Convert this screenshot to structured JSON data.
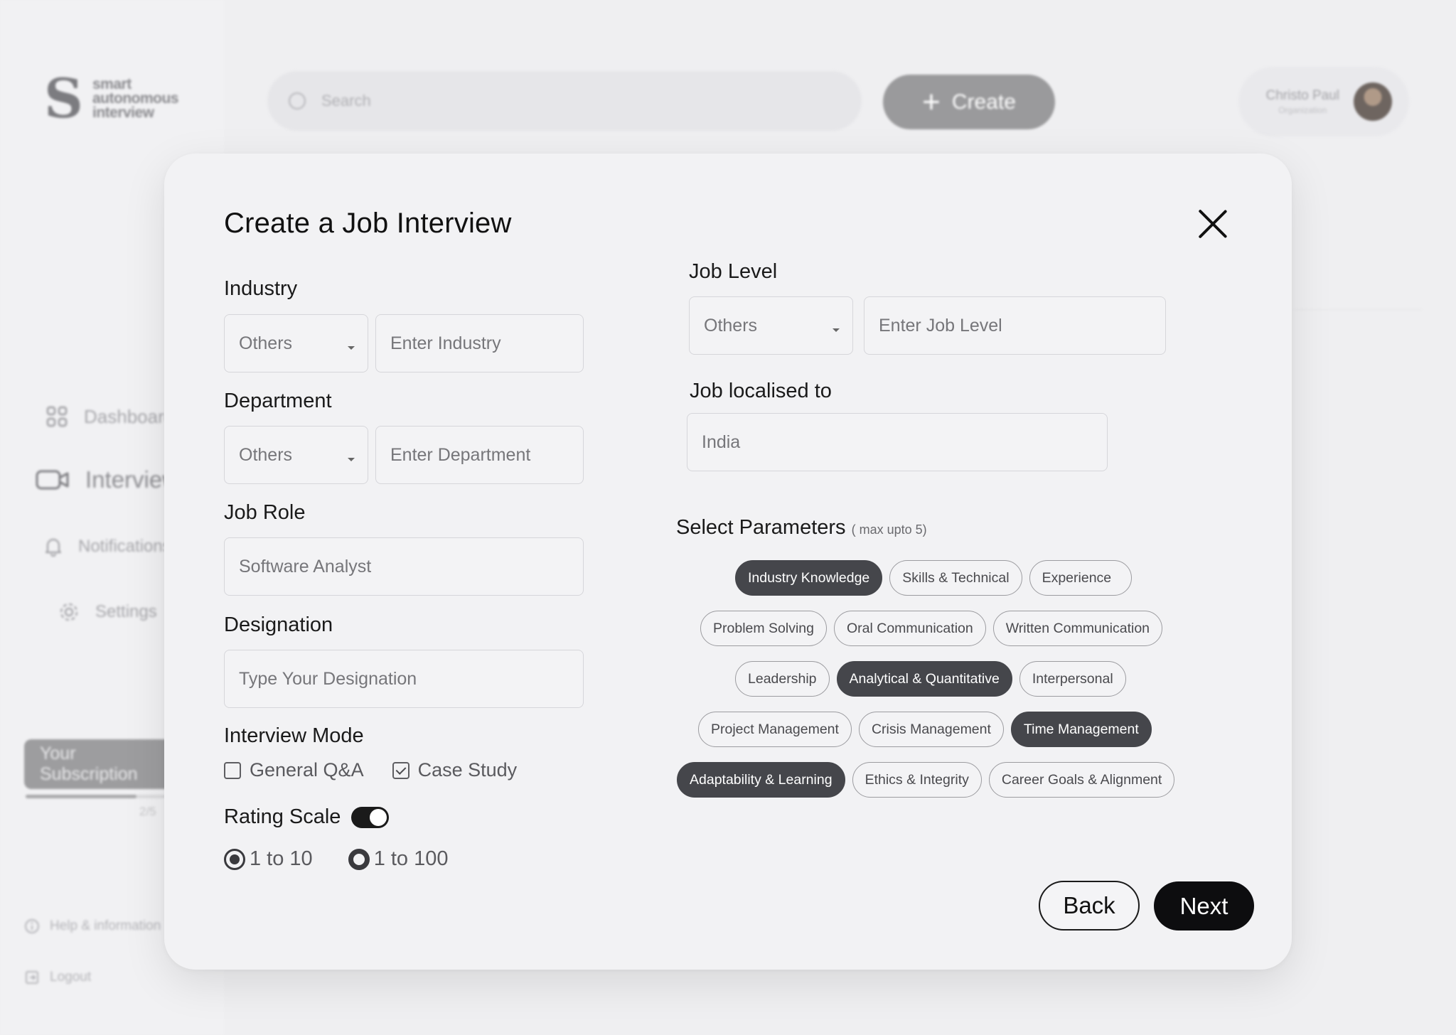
{
  "app": {
    "logo_lines": [
      "smart",
      "autonomous",
      "interview"
    ],
    "search_placeholder": "Search",
    "create_label": "Create",
    "user_name": "Christo Paul",
    "user_role": "Organization"
  },
  "sidebar": {
    "items": [
      {
        "label": "Dashboard",
        "icon": "grid-icon"
      },
      {
        "label": "Interviews",
        "icon": "video-camera-icon"
      },
      {
        "label": "Notifications",
        "icon": "bell-icon"
      },
      {
        "label": "Settings",
        "icon": "gear-icon"
      }
    ],
    "subscription_label": "Your Subscription",
    "subscription_count": "2/5",
    "subscription_progress": 0.78,
    "help_label": "Help & information",
    "logout_label": "Logout"
  },
  "modal": {
    "title": "Create a Job Interview",
    "industry": {
      "label": "Industry",
      "select_value": "Others",
      "input_placeholder": "Enter Industry"
    },
    "department": {
      "label": "Department",
      "select_value": "Others",
      "input_placeholder": "Enter  Department"
    },
    "job_role": {
      "label": "Job Role",
      "value": "Software Analyst"
    },
    "designation": {
      "label": "Designation",
      "placeholder": "Type Your Designation"
    },
    "interview_mode": {
      "label": "Interview Mode",
      "options": [
        {
          "label": "General Q&A",
          "checked": false
        },
        {
          "label": "Case Study",
          "checked": true
        }
      ]
    },
    "rating_scale": {
      "label": "Rating Scale",
      "toggle_on": true,
      "options": [
        {
          "label": "1 to 10",
          "selected": true
        },
        {
          "label": "1 to 100",
          "selected": false
        }
      ]
    },
    "job_level": {
      "label": "Job Level",
      "select_value": "Others",
      "input_placeholder": "Enter Job Level"
    },
    "job_localised": {
      "label": "Job localised to",
      "value": "India"
    },
    "parameters": {
      "title": "Select Parameters",
      "note": "( max upto 5)",
      "rows": [
        [
          {
            "label": "Industry Knowledge",
            "selected": true
          },
          {
            "label": "Skills & Technical",
            "selected": false
          },
          {
            "label": "Experience",
            "selected": false
          }
        ],
        [
          {
            "label": "Problem Solving",
            "selected": false
          },
          {
            "label": "Oral Communication",
            "selected": false
          },
          {
            "label": "Written Communication",
            "selected": false
          }
        ],
        [
          {
            "label": "Leadership",
            "selected": false
          },
          {
            "label": "Analytical & Quantitative",
            "selected": true
          },
          {
            "label": "Interpersonal",
            "selected": false
          }
        ],
        [
          {
            "label": "Project Management",
            "selected": false
          },
          {
            "label": "Crisis Management",
            "selected": false
          },
          {
            "label": "Time Management",
            "selected": true
          }
        ],
        [
          {
            "label": "Adaptability & Learning",
            "selected": true
          },
          {
            "label": "Ethics & Integrity",
            "selected": false
          },
          {
            "label": "Career Goals & Alignment",
            "selected": false
          }
        ]
      ]
    },
    "back_label": "Back",
    "next_label": "Next"
  }
}
